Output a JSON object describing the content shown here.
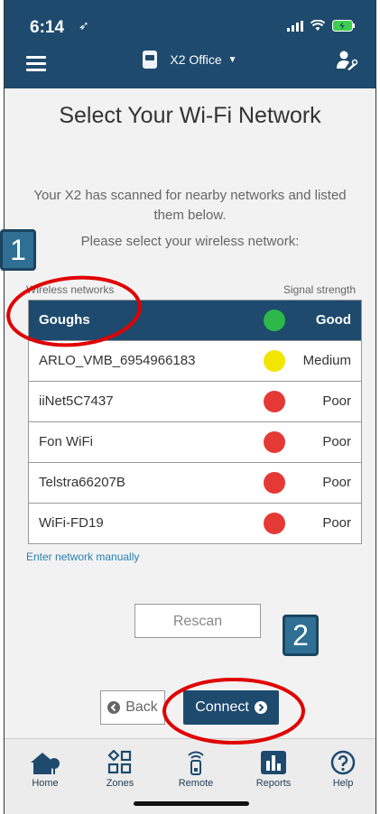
{
  "status": {
    "time": "6:14"
  },
  "header": {
    "device_title": "X2 Office"
  },
  "page": {
    "title": "Select Your Wi-Fi Network",
    "description": "Your X2 has scanned for nearby networks and listed them below.",
    "prompt": "Please select your wireless network:"
  },
  "list": {
    "col_left": "Wireless networks",
    "col_right": "Signal strength",
    "networks": [
      {
        "name": "Goughs",
        "strength": "Good",
        "color": "#2db84a",
        "selected": true
      },
      {
        "name": "ARLO_VMB_6954966183",
        "strength": "Medium",
        "color": "#f2e600",
        "selected": false
      },
      {
        "name": "iiNet5C7437",
        "strength": "Poor",
        "color": "#e53935",
        "selected": false
      },
      {
        "name": "Fon WiFi",
        "strength": "Poor",
        "color": "#e53935",
        "selected": false
      },
      {
        "name": "Telstra66207B",
        "strength": "Poor",
        "color": "#e53935",
        "selected": false
      },
      {
        "name": "WiFi-FD19",
        "strength": "Poor",
        "color": "#e53935",
        "selected": false
      }
    ]
  },
  "links": {
    "manual": "Enter network manually"
  },
  "buttons": {
    "rescan": "Rescan",
    "back": "Back",
    "connect": "Connect"
  },
  "annotations": {
    "badge1": "1",
    "badge2": "2"
  },
  "tabs": [
    {
      "label": "Home",
      "icon": "home-icon"
    },
    {
      "label": "Zones",
      "icon": "zones-icon"
    },
    {
      "label": "Remote",
      "icon": "remote-icon"
    },
    {
      "label": "Reports",
      "icon": "reports-icon"
    },
    {
      "label": "Help",
      "icon": "help-icon"
    }
  ],
  "colors": {
    "brand": "#1e4a6e",
    "link": "#2a7fb0",
    "annotation": "#e00000"
  }
}
